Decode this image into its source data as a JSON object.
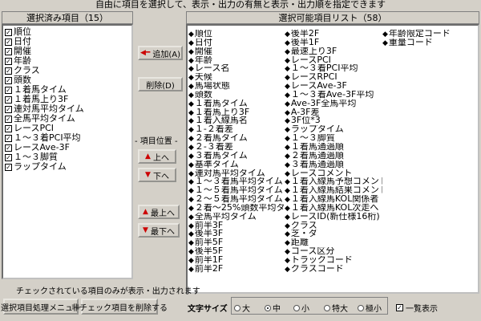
{
  "header": {
    "note": "自由に項目を選択して、表示・出力の有無と表示・出力順を指定できます"
  },
  "selected_panel": {
    "title": "選択済み項目（15）",
    "check_mark": "✓",
    "items": [
      "順位",
      "日付",
      "開催",
      "年齢",
      "クラス",
      "頭数",
      "１着馬タイム",
      "１着馬上り3F",
      "連対馬平均タイム",
      "全馬平均タイム",
      "レースPCI",
      "１〜３着PCI平均",
      "レースAve-3F",
      "１〜３脚質",
      "ラップタイム"
    ]
  },
  "available_panel": {
    "title": "選択可能項目リスト（58）",
    "marker": "◆",
    "col1": [
      "順位",
      "日付",
      "開催",
      "年齢",
      "レース名",
      "天候",
      "馬場状態",
      "頭数",
      "１着馬タイム",
      "１着馬上り3F",
      "１着入線馬名",
      "１-２着差",
      "２着馬タイム",
      "２-３着差",
      "３着馬タイム",
      "基準タイム",
      "連対馬平均タイム",
      "１〜３着馬平均タイム",
      "１〜５着馬平均タイム",
      "２〜５着馬平均タイム",
      "２着〜25%頭数平均タイム",
      "全馬平均タイム",
      "前半3F",
      "後半3F",
      "前半5F",
      "後半5F",
      "前半1F",
      "前半2F"
    ],
    "col2": [
      "後半2F",
      "後半1F",
      "最速上り3F",
      "レースPCI",
      "１〜３着PCI平均",
      "レースRPCI",
      "レースAve-3F",
      "１〜３着Ave-3F平均",
      "Ave-3F全馬平均",
      "A-3F差",
      "3F位*3",
      "ラップタイム",
      "１〜３脚質",
      "１着馬通過順",
      "２着馬通過順",
      "３着馬通過順",
      "レースコメント",
      "１着入線馬予想コメント",
      "１着入線馬結果コメント",
      "１着入線馬KOL関係者",
      "１着入線馬KOL次走へ",
      "レースID(新仕様16桁)",
      "クラス",
      "芝・ダ",
      "距離",
      "コース区分",
      "トラックコード",
      "クラスコード"
    ],
    "col3": [
      "年齢限定コード",
      "重量コード"
    ]
  },
  "buttons": {
    "add": "追加(A)",
    "delete": "削除(D)",
    "order_label": "- 項目位置 -",
    "up": "上へ",
    "down": "下へ",
    "top": "最上へ",
    "bottom": "最下へ"
  },
  "footer": {
    "note": "チェックされている項目のみが表示・出力されます",
    "menu_button": "選択項目処理メニュー",
    "remove_unchecked_button": "非チェック項目を削除する",
    "font_size_label": "文字サイズ",
    "font_sizes": [
      "大",
      "中",
      "小",
      "特大",
      "極小"
    ],
    "font_size_selected": "中",
    "list_display_label": "一覧表示",
    "list_display_checked": true
  },
  "colors": {
    "red_arrow": "#cc0000",
    "window_bg": "#d4d0c8"
  }
}
